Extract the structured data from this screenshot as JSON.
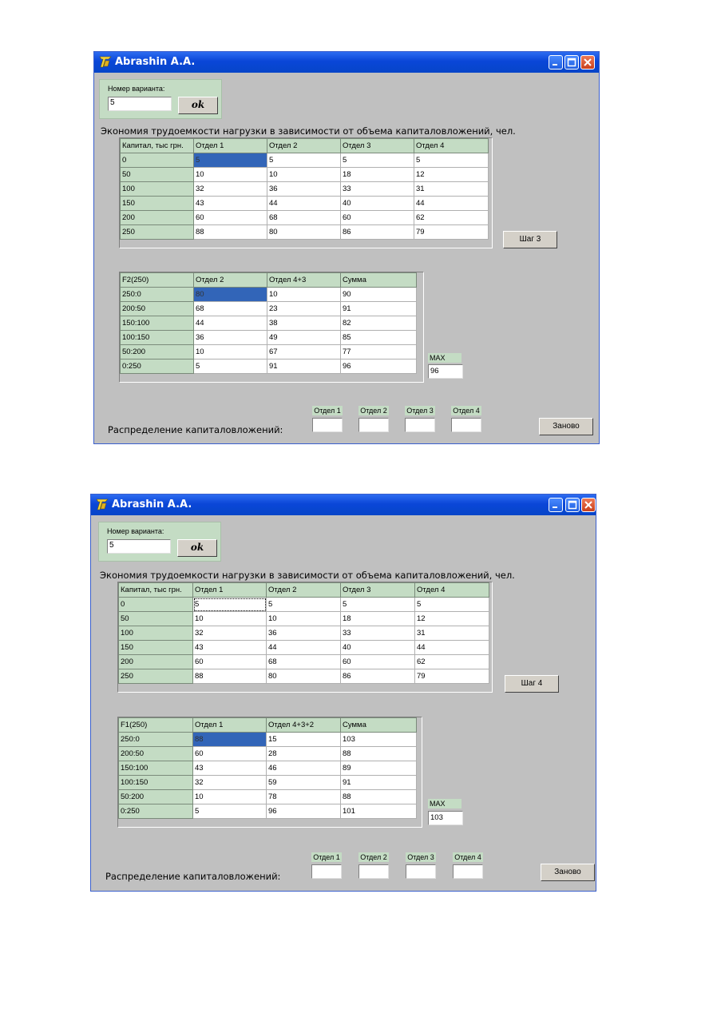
{
  "windows": [
    {
      "title": "Abrashin A.A.",
      "variant_label": "Номер варианта:",
      "variant_value": "5",
      "ok_label": "ok",
      "heading": "Экономия трудоемкости нагрузки в зависимости от объема капиталовложений, чел.",
      "main_table": {
        "headers": [
          "Капитал, тыс грн.",
          "Отдел 1",
          "Отдел 2",
          "Отдел 3",
          "Отдел 4"
        ],
        "rows": [
          [
            "0",
            "5",
            "5",
            "5",
            "5"
          ],
          [
            "50",
            "10",
            "10",
            "18",
            "12"
          ],
          [
            "100",
            "32",
            "36",
            "33",
            "31"
          ],
          [
            "150",
            "43",
            "44",
            "40",
            "44"
          ],
          [
            "200",
            "60",
            "68",
            "60",
            "62"
          ],
          [
            "250",
            "88",
            "80",
            "86",
            "79"
          ]
        ]
      },
      "step_label": "Шаг 3",
      "calc_table": {
        "headers": [
          "F2(250)",
          "Отдел 2",
          "Отдел 4+3",
          "Сумма"
        ],
        "rows": [
          [
            "250:0",
            "80",
            "10",
            "90"
          ],
          [
            "200:50",
            "68",
            "23",
            "91"
          ],
          [
            "150:100",
            "44",
            "38",
            "82"
          ],
          [
            "100:150",
            "36",
            "49",
            "85"
          ],
          [
            "50:200",
            "10",
            "67",
            "77"
          ],
          [
            "0:250",
            "5",
            "91",
            "96"
          ]
        ]
      },
      "max_label": "MAX",
      "max_value": "96",
      "dept_labels": [
        "Отдел 1",
        "Отдел 2",
        "Отдел 3",
        "Отдел 4"
      ],
      "distribution_label": "Распределение капиталовложений:",
      "reset_label": "Заново"
    },
    {
      "title": "Abrashin A.A.",
      "variant_label": "Номер варианта:",
      "variant_value": "5",
      "ok_label": "ok",
      "heading": "Экономия трудоемкости нагрузки в зависимости от объема капиталовложений, чел.",
      "main_table": {
        "headers": [
          "Капитал, тыс грн.",
          "Отдел 1",
          "Отдел 2",
          "Отдел 3",
          "Отдел 4"
        ],
        "rows": [
          [
            "0",
            "5",
            "5",
            "5",
            "5"
          ],
          [
            "50",
            "10",
            "10",
            "18",
            "12"
          ],
          [
            "100",
            "32",
            "36",
            "33",
            "31"
          ],
          [
            "150",
            "43",
            "44",
            "40",
            "44"
          ],
          [
            "200",
            "60",
            "68",
            "60",
            "62"
          ],
          [
            "250",
            "88",
            "80",
            "86",
            "79"
          ]
        ]
      },
      "step_label": "Шаг 4",
      "calc_table": {
        "headers": [
          "F1(250)",
          "Отдел 1",
          "Отдел 4+3+2",
          "Сумма"
        ],
        "rows": [
          [
            "250:0",
            "88",
            "15",
            "103"
          ],
          [
            "200:50",
            "60",
            "28",
            "88"
          ],
          [
            "150:100",
            "43",
            "46",
            "89"
          ],
          [
            "100:150",
            "32",
            "59",
            "91"
          ],
          [
            "50:200",
            "10",
            "78",
            "88"
          ],
          [
            "0:250",
            "5",
            "96",
            "101"
          ]
        ]
      },
      "max_label": "MAX",
      "max_value": "103",
      "dept_labels": [
        "Отдел 1",
        "Отдел 2",
        "Отдел 3",
        "Отдел 4"
      ],
      "distribution_label": "Распределение капиталовложений:",
      "reset_label": "Заново"
    }
  ]
}
